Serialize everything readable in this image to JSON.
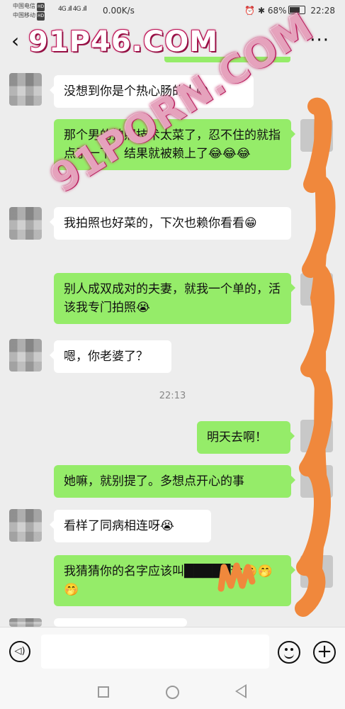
{
  "status_bar": {
    "carrier_1": "中国电信",
    "carrier_2": "中国移动",
    "hd": "HD",
    "signal": "4G .ıll 4G .ıll",
    "net_speed": "0.00K/s",
    "alarm": "⏰",
    "bluetooth": "✱",
    "battery": "68%",
    "time": "22:28"
  },
  "header": {
    "back_icon": "chevron-left-icon",
    "watermark": "91P46.COM",
    "more_icon": "more-dots-icon",
    "more_glyph": "···"
  },
  "diagonal_watermark": "91PORN.COM",
  "timestamp": "22:13",
  "messages": [
    {
      "side": "left",
      "text": "没想到你是个热心肠的人😁"
    },
    {
      "side": "right",
      "text": "那个男的拍照技术太菜了，忍不住的就指点了一下，结果就被赖上了😂😂😂"
    },
    {
      "side": "left",
      "text": "我拍照也好菜的，下次也赖你看看😁"
    },
    {
      "side": "right",
      "text": "别人成双成对的夫妻，就我一个单的，活该我专门拍照😭"
    },
    {
      "side": "left",
      "text": "嗯，你老婆了？"
    },
    {
      "side": "right",
      "text": "明天去啊！"
    },
    {
      "side": "right",
      "text": "她嘛，就别提了。多想点开心的事"
    },
    {
      "side": "left",
      "text": "看样了同病相连呀😭"
    },
    {
      "side": "right",
      "text": "我猜猜你的名字应该叫█████玲🤭🤭🤭"
    }
  ],
  "input_bar": {
    "voice_icon": "voice-icon",
    "voice_glyph": "◁)",
    "input_value": "",
    "emoji_icon": "emoji-icon",
    "add_icon": "add-icon",
    "add_glyph": "+"
  },
  "system_nav": {
    "recent": "recent-apps-icon",
    "home": "home-icon",
    "back": "back-icon"
  },
  "colors": {
    "background": "#ededed",
    "bubble_right": "#95ec69",
    "bubble_left": "#ffffff",
    "scribble": "#f0883c",
    "watermark": "#c0185a"
  }
}
